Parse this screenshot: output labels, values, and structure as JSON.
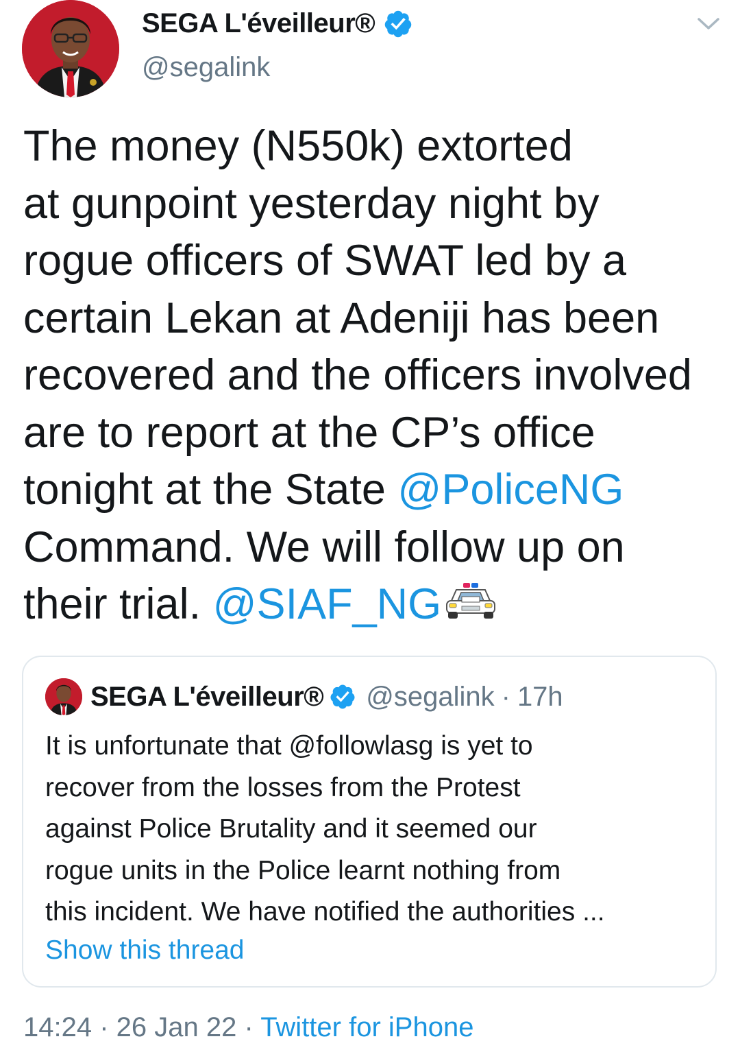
{
  "tweet": {
    "author": {
      "display_name": "SEGA L'éveilleur®",
      "handle": "@segalink",
      "verified": true
    },
    "lines": [
      [
        {
          "t": "The money (N550k) extorted"
        }
      ],
      [
        {
          "t": "at gunpoint yesterday night by"
        }
      ],
      [
        {
          "t": "rogue officers of SWAT led by a"
        }
      ],
      [
        {
          "t": "certain Lekan at Adeniji has been"
        }
      ],
      [
        {
          "t": "recovered and the officers involved"
        }
      ],
      [
        {
          "t": "are to report at the CP’s office"
        }
      ],
      [
        {
          "t": "tonight at the State "
        },
        {
          "t": "@PoliceNG",
          "mention": true
        }
      ],
      [
        {
          "t": "Command. We will follow up on"
        }
      ],
      [
        {
          "t": "their trial. "
        },
        {
          "t": "@SIAF_NG",
          "mention": true
        },
        {
          "emoji": "police-car"
        }
      ]
    ],
    "timestamp": "14:24",
    "date": "26 Jan 22",
    "source": "Twitter for iPhone",
    "separator": " · "
  },
  "quote": {
    "display_name": "SEGA L'éveilleur®",
    "handle": "@segalink",
    "separator": "·",
    "time": "17h",
    "lines": [
      [
        {
          "t": "It is unfortunate that @followlasg is yet to"
        }
      ],
      [
        {
          "t": "recover from the losses from the Protest"
        }
      ],
      [
        {
          "t": "against Police Brutality and it seemed our"
        }
      ],
      [
        {
          "t": "rogue units in the Police learnt nothing from"
        }
      ],
      [
        {
          "t": "this incident. We have notified the authorities ..."
        }
      ]
    ],
    "show_thread": "Show this thread"
  },
  "colors": {
    "link": "#1b95e0",
    "secondary": "#657786",
    "text": "#14171a",
    "border": "#e1e8ed",
    "verified": "#1da1f2"
  },
  "icons": {
    "verified": "verified-badge-icon",
    "chevron": "chevron-down-icon",
    "emoji": "police-car-emoji"
  }
}
